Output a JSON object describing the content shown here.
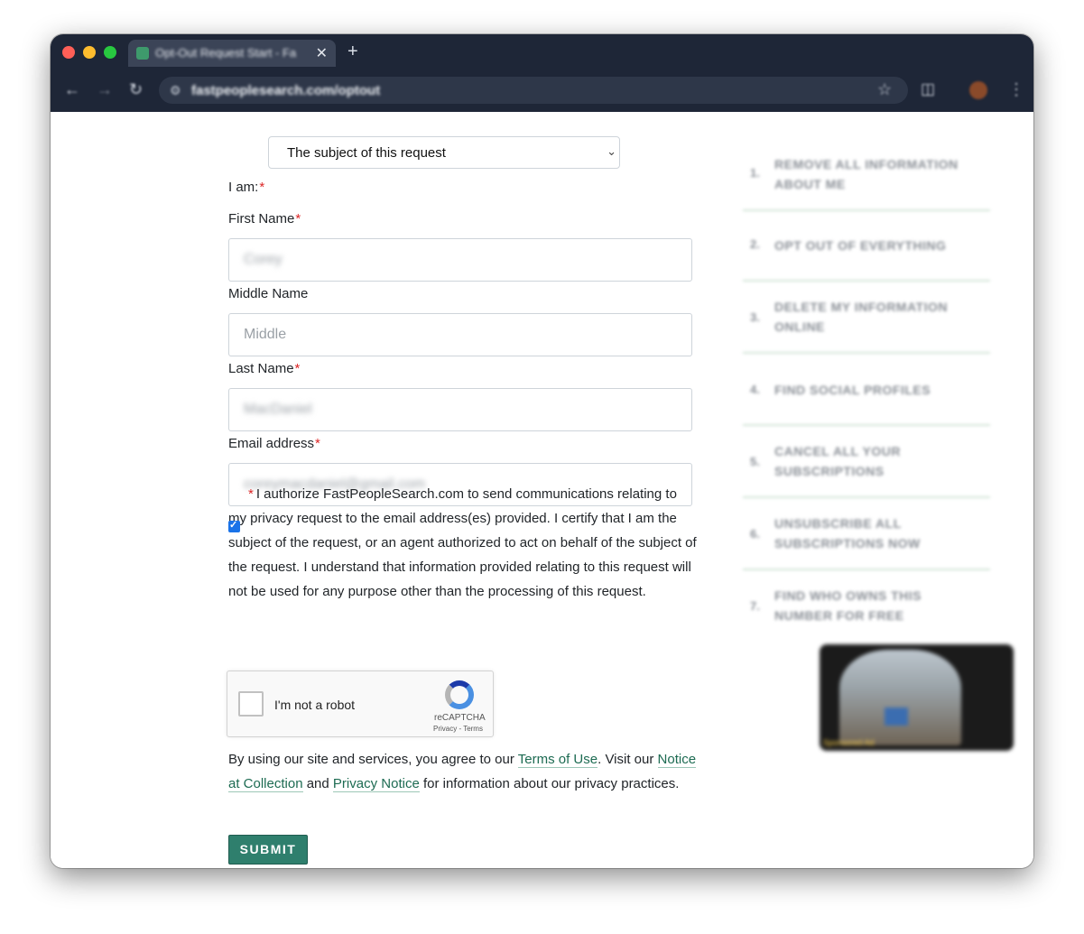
{
  "browser": {
    "tab_title": "Opt-Out Request Start - Fa",
    "close_glyph": "✕",
    "new_tab_glyph": "+",
    "url": "fastpeoplesearch.com/optout"
  },
  "form": {
    "iam_label": "I am:",
    "required_mark": "*",
    "iam_value": "The subject of this request",
    "first_name_label": "First Name",
    "first_name_value": "Corey",
    "middle_name_label": "Middle Name",
    "middle_name_placeholder": "Middle",
    "last_name_label": "Last Name",
    "last_name_value": "MacDaniel",
    "email_label": "Email address",
    "email_value": "coreymacdaniel@gmail.com",
    "consent_checked": true,
    "consent_text": "I authorize FastPeopleSearch.com to send communications relating to my privacy request to the email address(es) provided. I certify that I am the subject of the request, or an agent authorized to act on behalf of the subject of the request. I understand that information provided relating to this request will not be used for any purpose other than the processing of this request.",
    "captcha_label": "I'm not a robot",
    "captcha_brand": "reCAPTCHA",
    "captcha_links": "Privacy - Terms",
    "legal_prefix": "By using our site and services, you agree to our ",
    "terms_link": "Terms of Use",
    "legal_middle": ". Visit our ",
    "notice_link": "Notice at Collection",
    "legal_and": " and ",
    "privacy_link": "Privacy Notice",
    "legal_suffix": " for information about our privacy practices.",
    "submit_label": "SUBMIT"
  },
  "sidebar": {
    "items": [
      {
        "num": "1.",
        "label": "REMOVE ALL INFORMATION ABOUT ME"
      },
      {
        "num": "2.",
        "label": "OPT OUT OF EVERYTHING"
      },
      {
        "num": "3.",
        "label": "DELETE MY INFORMATION ONLINE"
      },
      {
        "num": "4.",
        "label": "FIND SOCIAL PROFILES"
      },
      {
        "num": "5.",
        "label": "CANCEL ALL YOUR SUBSCRIPTIONS"
      },
      {
        "num": "6.",
        "label": "UNSUBSCRIBE ALL SUBSCRIPTIONS NOW"
      },
      {
        "num": "7.",
        "label": "FIND WHO OWNS THIS NUMBER FOR FREE"
      }
    ]
  },
  "video": {
    "caption": "Sponsored Ad"
  },
  "icons": {
    "back": "back-arrow-icon",
    "forward": "forward-arrow-icon",
    "reload": "reload-icon",
    "site_settings": "site-settings-icon",
    "bookmark": "star-icon",
    "side_panel": "side-panel-icon",
    "menu": "more-menu-icon",
    "select": "chevron-down-icon",
    "scroll_top": "chevron-up-icon"
  },
  "colors": {
    "chrome_bg": "#1e2637",
    "submit_bg": "#2f7f6d",
    "link": "#1d6b52",
    "required": "#dc2626"
  }
}
